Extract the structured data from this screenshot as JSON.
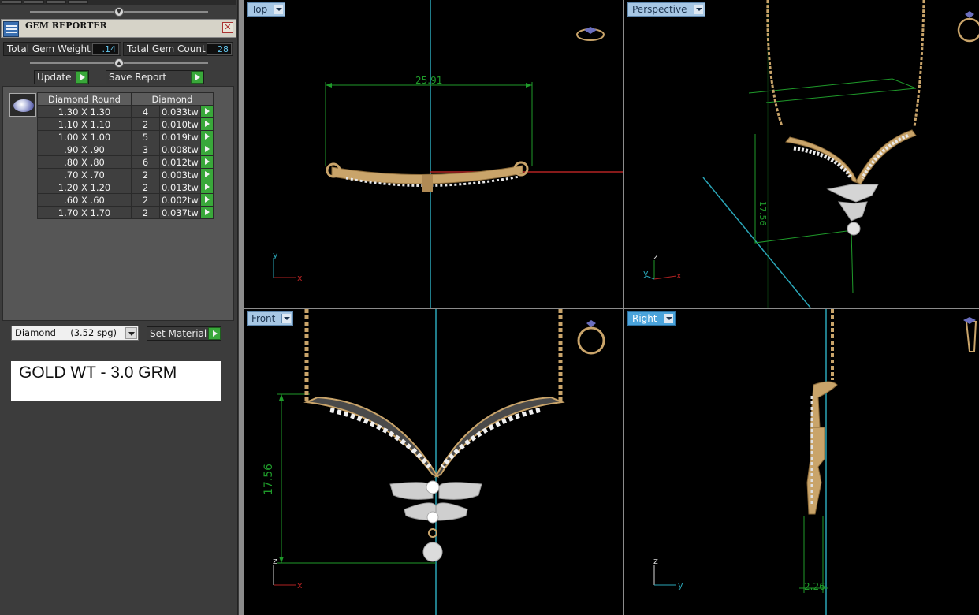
{
  "gem_reporter": {
    "title": "GEM REPORTER",
    "total_weight_label": "Total Gem Weight",
    "total_weight_value": ".14",
    "total_count_label": "Total Gem Count",
    "total_count_value": "28",
    "update_label": "Update",
    "save_report_label": "Save Report",
    "table": {
      "col_shape": "Diamond Round",
      "col_material": "Diamond",
      "rows": [
        {
          "size": "1.30 X 1.30",
          "count": "4",
          "weight": "0.033tw"
        },
        {
          "size": "1.10 X 1.10",
          "count": "2",
          "weight": "0.010tw"
        },
        {
          "size": "1.00 X 1.00",
          "count": "5",
          "weight": "0.019tw"
        },
        {
          "size": ".90 X .90",
          "count": "3",
          "weight": "0.008tw"
        },
        {
          "size": ".80 X .80",
          "count": "6",
          "weight": "0.012tw"
        },
        {
          "size": ".70 X .70",
          "count": "2",
          "weight": "0.003tw"
        },
        {
          "size": "1.20 X 1.20",
          "count": "2",
          "weight": "0.013tw"
        },
        {
          "size": ".60 X .60",
          "count": "2",
          "weight": "0.002tw"
        },
        {
          "size": "1.70 X 1.70",
          "count": "2",
          "weight": "0.037tw"
        }
      ]
    },
    "material_select": "Diamond     (3.52 spg)",
    "set_material_label": "Set Material",
    "note": "GOLD WT - 3.0 GRM"
  },
  "viewports": {
    "top": {
      "label": "Top",
      "dimension": "25.91",
      "axis_a": "y",
      "axis_b": "x"
    },
    "perspective": {
      "label": "Perspective",
      "dimension": "17.56",
      "axis_a": "z",
      "axis_b": "y",
      "axis_c": "x"
    },
    "front": {
      "label": "Front",
      "dimension": "17.56",
      "axis_a": "z",
      "axis_b": "x"
    },
    "right": {
      "label": "Right",
      "dimension": "2.26",
      "axis_a": "z",
      "axis_b": "y"
    }
  },
  "colors": {
    "gold": "#c9a46a",
    "accent_green": "#39a83a",
    "dimension_green": "#1f9a2a",
    "axis_cyan": "#2aa6b8",
    "active_tab": "#4aa3db"
  }
}
